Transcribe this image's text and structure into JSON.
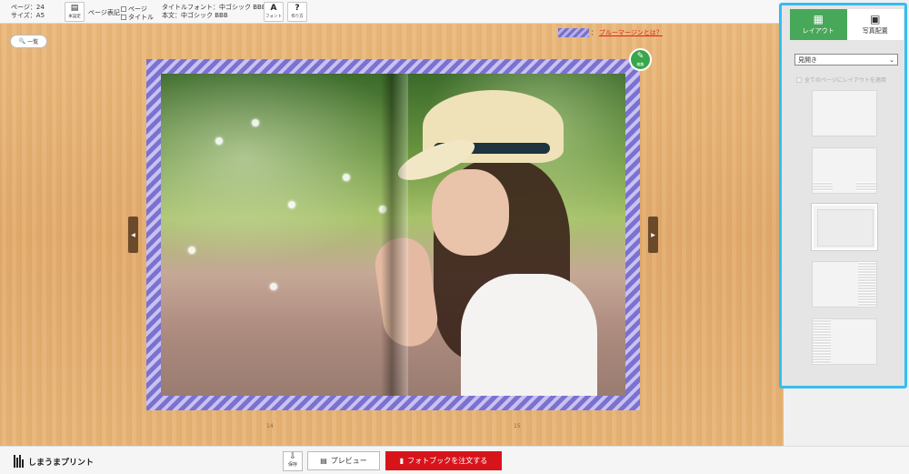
{
  "toolbar": {
    "page_count": "ページ：24",
    "size": "サイズ：A5",
    "book_settings": {
      "icon": "book-icon",
      "label": "本設定"
    },
    "page_notation_label": "ページ表記：",
    "notation_page": "ページ",
    "notation_title": "タイトル",
    "title_font": "タイトルフォント：中ゴシック BBB",
    "body_font": "本文：中ゴシック BBB",
    "font_button": {
      "icon": "A",
      "label": "フォント"
    },
    "howto_button": {
      "icon": "?",
      "label": "作り方"
    }
  },
  "canvas": {
    "list_button": "一覧",
    "blue_margin_prefix": "：",
    "blue_margin_link": "ブルーマージンとは？",
    "edit_label": "編集",
    "prev_arrow": "◀",
    "next_arrow": "▶",
    "page_left": "14",
    "page_right": "15"
  },
  "panel": {
    "tabs": [
      {
        "label": "レイアウト",
        "icon": "layout-grid-icon",
        "active": true
      },
      {
        "label": "写真配置",
        "icon": "photo-add-icon",
        "active": false
      }
    ],
    "select_value": "見開き",
    "apply_all_label": "全てのページにレイアウトを適用"
  },
  "bottombar": {
    "logo_text": "しまうまプリント",
    "save_label": "保存",
    "preview_label": "プレビュー",
    "order_label": "フォトブックを注文する"
  },
  "colors": {
    "accent_green": "#47a859",
    "order_red": "#d8141b",
    "panel_highlight": "#34bdf0",
    "blue_margin_stripe": "#7b72cf"
  }
}
